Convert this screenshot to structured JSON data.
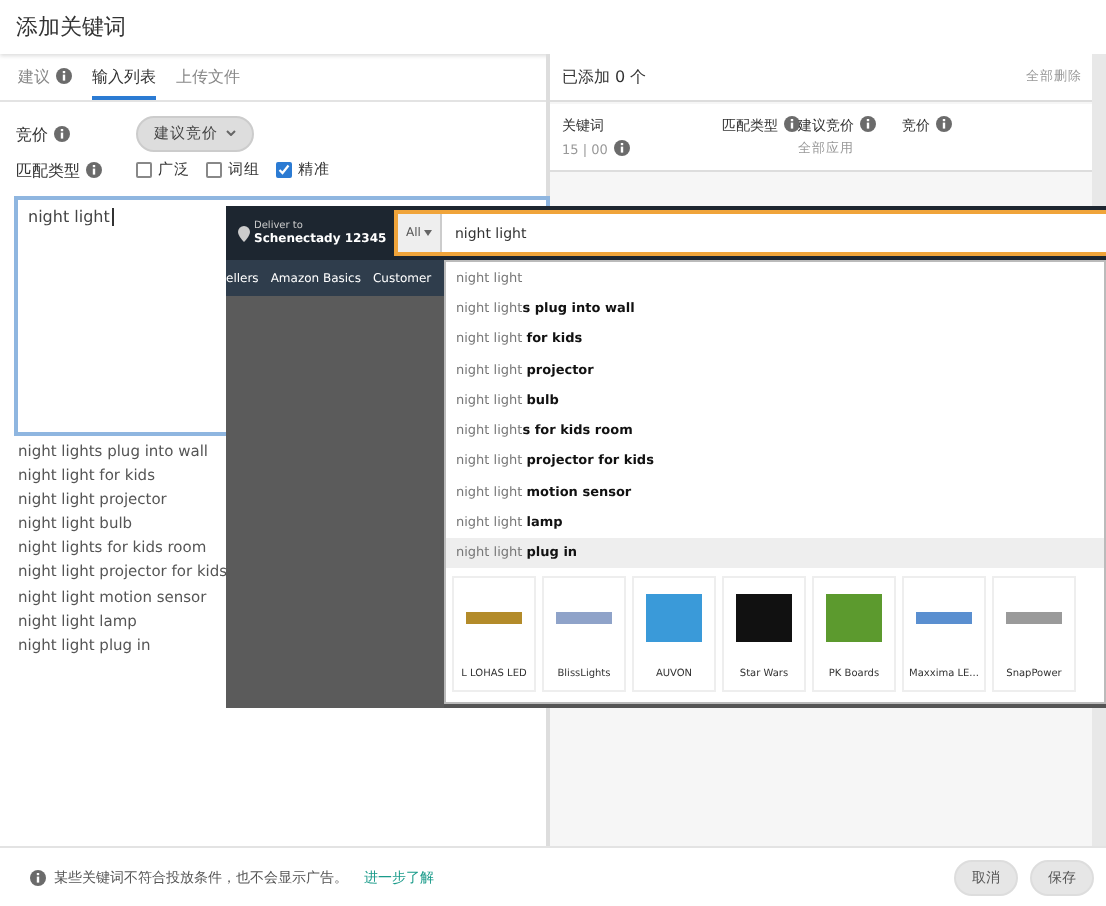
{
  "dialog": {
    "title": "添加关键词"
  },
  "tabs": [
    {
      "label": "建议",
      "info": true,
      "selected": false
    },
    {
      "label": "输入列表",
      "info": false,
      "selected": true
    },
    {
      "label": "上传文件",
      "info": false,
      "selected": false
    }
  ],
  "bid": {
    "label": "竞价",
    "value": "建议竞价"
  },
  "match_type": {
    "label": "匹配类型",
    "options": [
      {
        "label": "广泛",
        "checked": false
      },
      {
        "label": "词组",
        "checked": false
      },
      {
        "label": "精准",
        "checked": true
      }
    ]
  },
  "keyword_input": {
    "value": "night light"
  },
  "keyword_list": [
    "night lights plug into wall",
    "night light for kids",
    "night light projector",
    "night light bulb",
    "night lights for kids room",
    "night light projector for kids",
    "night light motion sensor",
    "night light lamp",
    "night light plug in"
  ],
  "added_panel": {
    "title": "已添加 0 个",
    "clear_all": "全部删除",
    "columns": [
      {
        "label": "关键词",
        "sub": "15 | 00"
      },
      {
        "label": "匹配类型"
      },
      {
        "label": "建议竞价",
        "sub": "全部应用"
      },
      {
        "label": "竞价"
      }
    ]
  },
  "amazon_screenshot": {
    "deliver_label": "Deliver to",
    "location": "Schenectady 12345",
    "category": "All",
    "search_value": "night light",
    "nav": [
      "ellers",
      "Amazon Basics",
      "Customer"
    ],
    "suggestions": [
      {
        "text": "night light",
        "selected": false
      },
      {
        "text": "night light**s plug into wall**",
        "selected": false
      },
      {
        "text": "night light **for kids**",
        "selected": false
      },
      {
        "text": "night light **projector**",
        "selected": false
      },
      {
        "text": "night light **bulb**",
        "selected": false
      },
      {
        "text": "night light**s for kids room**",
        "selected": false
      },
      {
        "text": "night light **projector for kids**",
        "selected": false
      },
      {
        "text": "night light **motion sensor**",
        "selected": false
      },
      {
        "text": "night light **lamp**",
        "selected": false
      },
      {
        "text": "night light **plug in**",
        "selected": true
      }
    ],
    "brands": [
      {
        "name": "L LOHAS LED",
        "color": "#b38b2a"
      },
      {
        "name": "BlissLights",
        "color": "#8fa3c9"
      },
      {
        "name": "AUVON",
        "color": "#3a9ad9"
      },
      {
        "name": "Star Wars",
        "color": "#111111"
      },
      {
        "name": "PK Boards",
        "color": "#5c9a2e"
      },
      {
        "name": "Maxxima LE...",
        "color": "#5a8fd0"
      },
      {
        "name": "SnapPower",
        "color": "#9a9a9a"
      }
    ]
  },
  "footer": {
    "notice": "某些关键词不符合投放条件，也不会显示广告。",
    "link": "进一步了解",
    "buttons": [
      "取消",
      "保存"
    ]
  }
}
